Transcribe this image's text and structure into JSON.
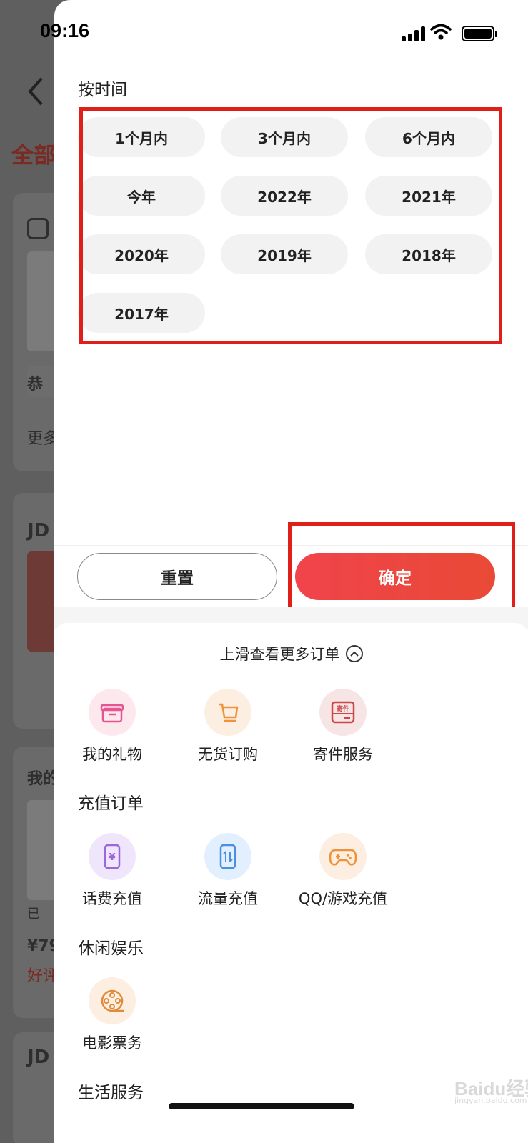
{
  "status_bar": {
    "time": "09:16"
  },
  "background": {
    "title_fragment": "全部",
    "text_1": "恭",
    "text_2": "更多",
    "text_3": "JD",
    "text_4": "我的",
    "text_5": "已",
    "price": "¥79",
    "review": "好评",
    "text_6": "JD"
  },
  "filter": {
    "section_title": "按时间",
    "options": [
      "1个月内",
      "3个月内",
      "6个月内",
      "今年",
      "2022年",
      "2021年",
      "2020年",
      "2019年",
      "2018年",
      "2017年"
    ],
    "reset_label": "重置",
    "confirm_label": "确定"
  },
  "more_orders": {
    "swipe_hint": "上滑查看更多订单",
    "top_items": [
      {
        "label": "我的礼物",
        "icon": "gift-icon",
        "bg": "#fde8ee",
        "color": "#e8548f"
      },
      {
        "label": "无货订购",
        "icon": "cart-icon",
        "bg": "#fdeee2",
        "color": "#f0923a"
      },
      {
        "label": "寄件服务",
        "icon": "package-icon",
        "bg": "#f7e4e4",
        "color": "#c94848",
        "badge": "寄件"
      }
    ],
    "recharge_title": "充值订单",
    "recharge_items": [
      {
        "label": "话费充值",
        "icon": "phone-yuan-icon",
        "bg": "#efe6fb",
        "color": "#9b66e0"
      },
      {
        "label": "流量充值",
        "icon": "data-traffic-icon",
        "bg": "#e2efff",
        "color": "#4a8fe0"
      },
      {
        "label": "QQ/游戏充值",
        "icon": "gamepad-icon",
        "bg": "#fdeee2",
        "color": "#f0923a"
      }
    ],
    "leisure_title": "休闲娱乐",
    "leisure_items": [
      {
        "label": "电影票务",
        "icon": "film-reel-icon",
        "bg": "#fdeee2",
        "color": "#e08a3a"
      }
    ],
    "life_title": "生活服务"
  },
  "watermark": {
    "text": "Baidu经验",
    "sub": "jingyan.baidu.com"
  }
}
